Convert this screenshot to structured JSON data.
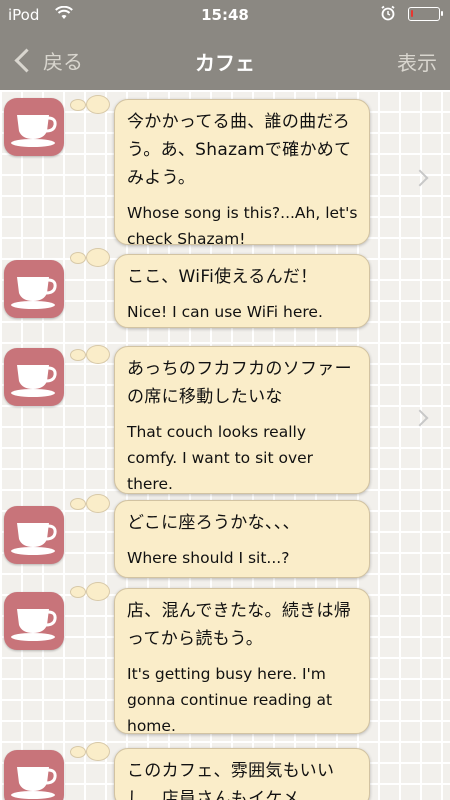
{
  "status_bar": {
    "carrier": "iPod",
    "time": "15:48",
    "wifi_icon": "wifi-icon",
    "alarm_icon": "alarm-clock-icon",
    "battery_level": 0.08,
    "battery_color": "#e8352e"
  },
  "nav": {
    "back_label": "戻る",
    "title": "カフェ",
    "display_label": "表示"
  },
  "colors": {
    "bar": "#8b8882",
    "icon_tile": "#c8747a",
    "bubble": "#faedc9"
  },
  "phrases": [
    {
      "jp": "今かかってる曲、誰の曲だろう。あ、Shazamで確かめてみよう。",
      "en": "Whose song is this?...Ah, let's check Shazam!",
      "has_chevron": true
    },
    {
      "jp": "ここ、WiFi使えるんだ！",
      "en": "Nice! I can use WiFi here.",
      "has_chevron": false
    },
    {
      "jp": "あっちのフカフカのソファーの席に移動したいな",
      "en": "That couch looks really comfy. I want to sit over there.",
      "has_chevron": true
    },
    {
      "jp": "どこに座ろうかな、、、",
      "en": "Where should I sit...?",
      "has_chevron": false
    },
    {
      "jp": "店、混んできたな。続きは帰ってから読もう。",
      "en": "It's getting busy here. I'm gonna continue reading at home.",
      "has_chevron": false
    },
    {
      "jp": "このカフェ、雰囲気もいいし、店員さんもイケメ",
      "en": "",
      "has_chevron": false
    }
  ]
}
